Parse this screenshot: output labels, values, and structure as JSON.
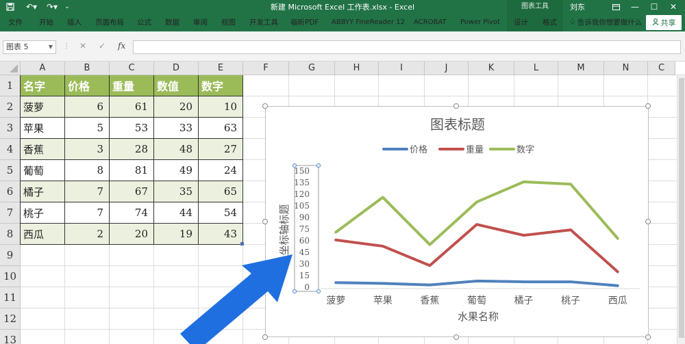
{
  "titlebar": {
    "title": "新建 Microsoft Excel 工作表.xlsx  -  Excel",
    "context_group": "图表工具",
    "user": "刘东"
  },
  "ribbon": {
    "tabs": [
      "文件",
      "开始",
      "插入",
      "页面布局",
      "公式",
      "数据",
      "审阅",
      "视图",
      "开发工具",
      "福昕PDF",
      "ABBYY FineReader 12",
      "ACROBAT",
      "Power Pivot",
      "设计",
      "格式"
    ],
    "tell_me": "告诉我你想要做什么",
    "share": "共享"
  },
  "formula_bar": {
    "name_box": "图表 5",
    "fx": "fx",
    "value": ""
  },
  "sheet": {
    "columns": [
      "A",
      "B",
      "C",
      "D",
      "E",
      "F",
      "G",
      "H",
      "I",
      "J",
      "K",
      "L",
      "M",
      "N",
      "C"
    ],
    "rows": [
      "1",
      "2",
      "3",
      "4",
      "5",
      "6",
      "7",
      "8",
      "9",
      "10",
      "11",
      "12",
      "13"
    ],
    "headers": [
      "名字",
      "价格",
      "重量",
      "数值",
      "数字"
    ],
    "data": [
      [
        "菠萝",
        "6",
        "61",
        "20",
        "10"
      ],
      [
        "苹果",
        "5",
        "53",
        "33",
        "63"
      ],
      [
        "香蕉",
        "3",
        "28",
        "48",
        "27"
      ],
      [
        "葡萄",
        "8",
        "81",
        "49",
        "24"
      ],
      [
        "橘子",
        "7",
        "67",
        "35",
        "65"
      ],
      [
        "桃子",
        "7",
        "74",
        "44",
        "54"
      ],
      [
        "西瓜",
        "2",
        "20",
        "19",
        "43"
      ]
    ]
  },
  "chart_data": {
    "type": "line",
    "title": "图表标题",
    "xlabel": "水果名称",
    "ylabel": "坐标轴标题",
    "categories": [
      "菠萝",
      "苹果",
      "香蕉",
      "葡萄",
      "橘子",
      "桃子",
      "西瓜"
    ],
    "series": [
      {
        "name": "价格",
        "color": "#4f81bd",
        "values": [
          6,
          5,
          3,
          8,
          7,
          7,
          2
        ]
      },
      {
        "name": "重量",
        "color": "#c0504d",
        "values": [
          61,
          53,
          28,
          81,
          67,
          74,
          20
        ]
      },
      {
        "name": "数字",
        "color": "#9bbb59",
        "values": [
          71,
          116,
          55,
          110,
          136,
          133,
          63
        ]
      }
    ],
    "yticks": [
      "0",
      "15",
      "30",
      "45",
      "60",
      "75",
      "90",
      "105",
      "120",
      "135",
      "150"
    ],
    "ylim": [
      0,
      150
    ],
    "legend_position": "top",
    "grid": false
  },
  "colors": {
    "excel_green": "#217346",
    "header_fill": "#9bbb59",
    "band_fill": "#ebf1de",
    "arrow": "#1f6fe0"
  }
}
